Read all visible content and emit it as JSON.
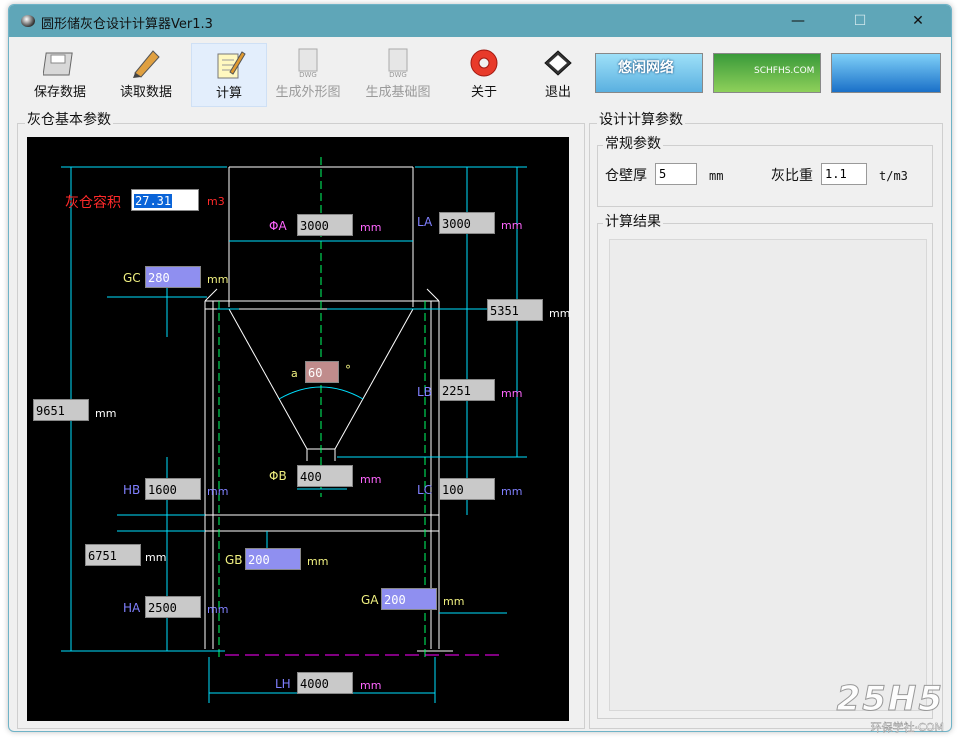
{
  "window": {
    "title": "圆形储灰仓设计计算器Ver1.3",
    "minimize": "—",
    "maximize": "☐",
    "close": "✕"
  },
  "toolbar": {
    "save": "保存数据",
    "load": "读取数据",
    "calc": "计算",
    "gen_outline": "生成外形图",
    "gen_base": "生成基础图",
    "about": "关于",
    "exit": "退出"
  },
  "banners": [
    "悠闲网络",
    "SCHFHS.COM",
    ""
  ],
  "left_group": {
    "title": "灰仓基本参数"
  },
  "drawing": {
    "volume_label": "灰仓容积",
    "volume_value": "27.31",
    "volume_unit": "m3",
    "phiA_label": "ΦA",
    "phiA_value": "3000",
    "LA_label": "LA",
    "LA_value": "3000",
    "GC_label": "GC",
    "GC_value": "280",
    "right_total_value": "5351",
    "angle_label": "a",
    "angle_value": "60",
    "angle_unit": "°",
    "LB_label": "LB",
    "LB_value": "2251",
    "left_total_value": "9651",
    "phiB_label": "ΦB",
    "phiB_value": "400",
    "HB_label": "HB",
    "HB_value": "1600",
    "LC_label": "LC",
    "LC_value": "100",
    "mid_total_value": "6751",
    "GB_label": "GB",
    "GB_value": "200",
    "GA_label": "GA",
    "GA_value": "200",
    "HA_label": "HA",
    "HA_value": "2500",
    "LH_label": "LH",
    "LH_value": "4000",
    "unit": "mm"
  },
  "right_group": {
    "title": "设计计算参数",
    "general_title": "常规参数",
    "wall_label": "仓壁厚",
    "wall_value": "5",
    "wall_unit": "mm",
    "density_label": "灰比重",
    "density_value": "1.1",
    "density_unit": "t/m3",
    "result_title": "计算结果"
  },
  "watermark": {
    "line1": "25H5",
    "line2": "环保学社·COM"
  }
}
